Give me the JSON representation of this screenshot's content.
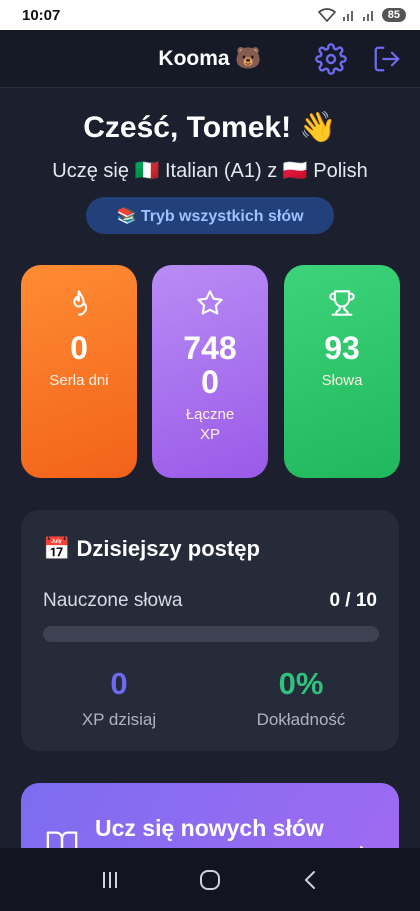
{
  "status_bar": {
    "time": "10:07",
    "battery": "85"
  },
  "header": {
    "title": "Kooma 🐻",
    "settings_icon": "gear-icon",
    "logout_icon": "logout-icon",
    "accent_color": "#6d6af0"
  },
  "greeting": {
    "text": "Cześć, Tomek! 👋",
    "learning": "Uczę się 🇮🇹 Italian (A1) z 🇵🇱 Polish"
  },
  "mode_pill": {
    "label": "📚 Tryb wszystkich słów"
  },
  "stats": [
    {
      "icon": "flame-icon",
      "value": "0",
      "label": "Serla dni",
      "color": "#f2621a"
    },
    {
      "icon": "star-icon",
      "value": "7480",
      "label": "Łączne XP",
      "color": "#9a5ae8"
    },
    {
      "icon": "trophy-icon",
      "value": "93",
      "label": "Słowa",
      "color": "#20b85c"
    }
  ],
  "daily_progress": {
    "title": "📅 Dzisiejszy postęp",
    "learned_label": "Nauczone słowa",
    "learned_value": "0 / 10",
    "progress_fraction": 0,
    "xp_today_value": "0",
    "xp_today_label": "XP dzisiaj",
    "accuracy_value": "0%",
    "accuracy_label": "Dokładność"
  },
  "learn_card": {
    "label": "Ucz się nowych słów",
    "icon": "book-icon"
  },
  "nav_bar": {
    "recents_icon": "recents-icon",
    "home_icon": "home-icon",
    "back_icon": "back-icon"
  }
}
